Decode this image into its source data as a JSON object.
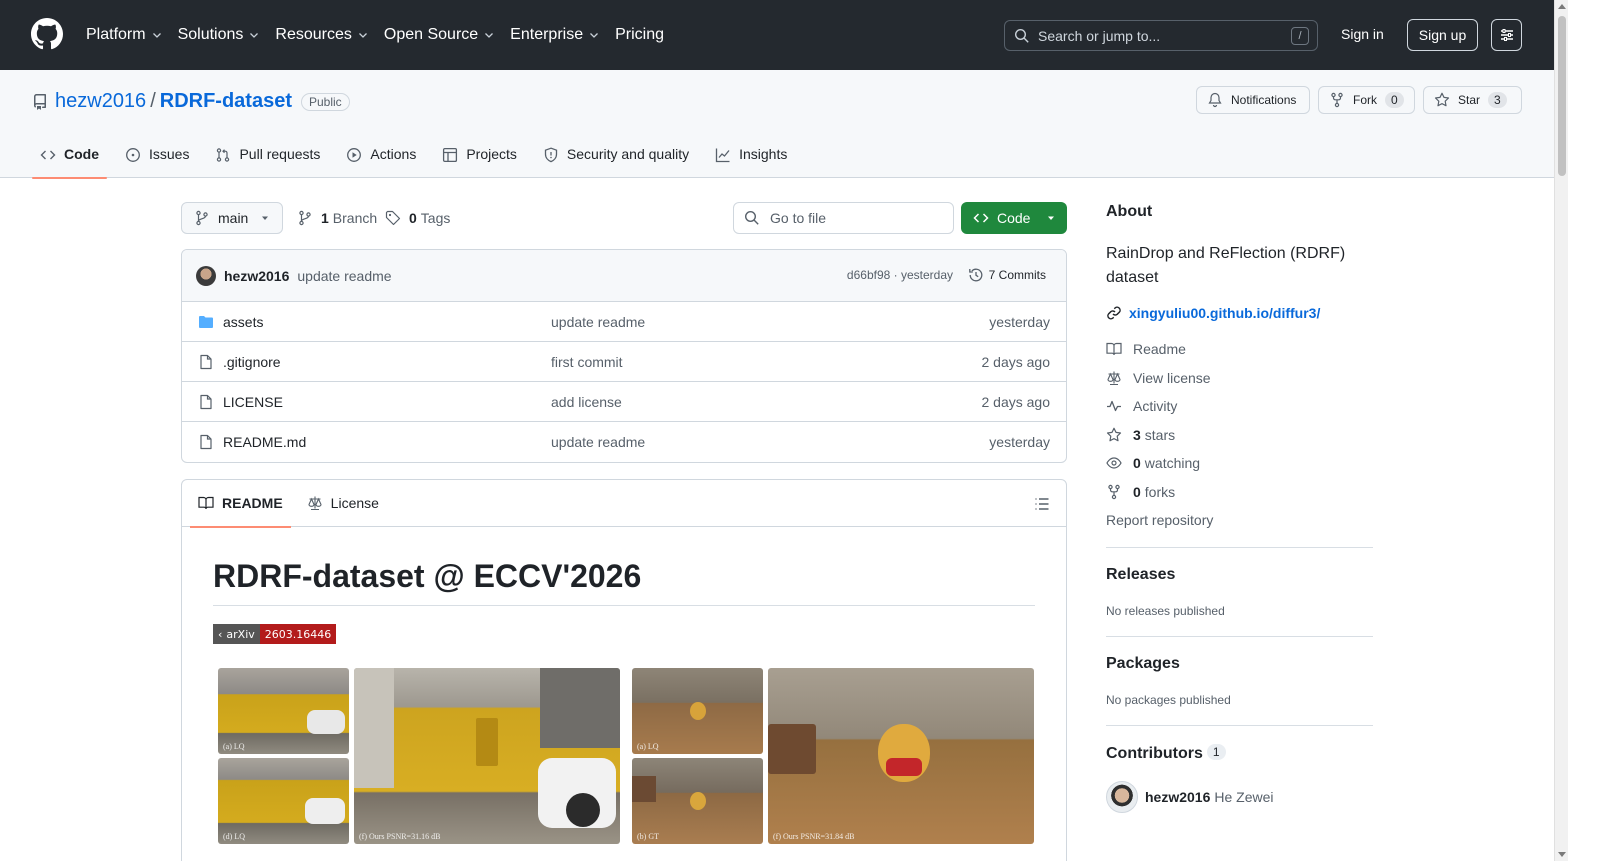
{
  "header": {
    "nav": [
      "Platform",
      "Solutions",
      "Resources",
      "Open Source",
      "Enterprise",
      "Pricing"
    ],
    "nav_has_caret": [
      true,
      true,
      true,
      true,
      true,
      false
    ],
    "search_placeholder": "Search or jump to...",
    "search_shortcut": "/",
    "sign_in": "Sign in",
    "sign_up": "Sign up"
  },
  "repo": {
    "owner": "hezw2016",
    "separator": "/",
    "name": "RDRF-dataset",
    "visibility": "Public",
    "notifications_label": "Notifications",
    "fork_label": "Fork",
    "fork_count": "0",
    "star_label": "Star",
    "star_count": "3"
  },
  "tabs": [
    {
      "label": "Code",
      "icon": "code-icon",
      "active": true
    },
    {
      "label": "Issues",
      "icon": "issue-opened-icon",
      "active": false
    },
    {
      "label": "Pull requests",
      "icon": "git-pull-request-icon",
      "active": false
    },
    {
      "label": "Actions",
      "icon": "play-icon",
      "active": false
    },
    {
      "label": "Projects",
      "icon": "table-icon",
      "active": false
    },
    {
      "label": "Security and quality",
      "icon": "shield-icon",
      "active": false
    },
    {
      "label": "Insights",
      "icon": "graph-icon",
      "active": false
    }
  ],
  "toolbar": {
    "branch": "main",
    "branch_count": "1",
    "branch_label": "Branch",
    "tag_count": "0",
    "tag_label": "Tags",
    "goto_placeholder": "Go to file",
    "code_label": "Code"
  },
  "commit": {
    "user": "hezw2016",
    "message": "update readme",
    "meta": "d66bf98 · yesterday",
    "commits": "7 Commits"
  },
  "files": [
    {
      "name": "assets",
      "type": "folder",
      "message": "update readme",
      "date": "yesterday"
    },
    {
      "name": ".gitignore",
      "type": "file",
      "message": "first commit",
      "date": "2 days ago"
    },
    {
      "name": "LICENSE",
      "type": "file",
      "message": "add license",
      "date": "2 days ago"
    },
    {
      "name": "README.md",
      "type": "file",
      "message": "update readme",
      "date": "yesterday"
    }
  ],
  "readme": {
    "tab_readme": "README",
    "tab_license": "License",
    "title": "RDRF-dataset @ ECCV'2026",
    "badge_left": "arXiv",
    "badge_right": "2603.16446",
    "captions": {
      "a": "(a) LQ",
      "d": "(d) LQ",
      "f": "(f) Ours PSNR=31.16 dB",
      "r_a": "(a) LQ",
      "r_b": "(b) GT",
      "r_f": "(f) Ours PSNR=31.84 dB"
    }
  },
  "sidebar": {
    "about_title": "About",
    "description": "RainDrop and ReFlection (RDRF) dataset",
    "link": "xingyuliu00.github.io/diffur3/",
    "readme": "Readme",
    "license": "View license",
    "activity": "Activity",
    "stars_count": "3",
    "stars_label": "stars",
    "watching_count": "0",
    "watching_label": "watching",
    "forks_count": "0",
    "forks_label": "forks",
    "report": "Report repository",
    "releases_title": "Releases",
    "releases_sub": "No releases published",
    "packages_title": "Packages",
    "packages_sub": "No packages published",
    "contributors_title": "Contributors",
    "contributors_count": "1",
    "contributor_user": "hezw2016",
    "contributor_name": "He Zewei"
  },
  "colors": {
    "header_bg": "#24292f",
    "link": "#0969da",
    "primary_button": "#1f883d",
    "active_tab_underline": "#fd8c73",
    "arxiv_red": "#b31b1b"
  }
}
